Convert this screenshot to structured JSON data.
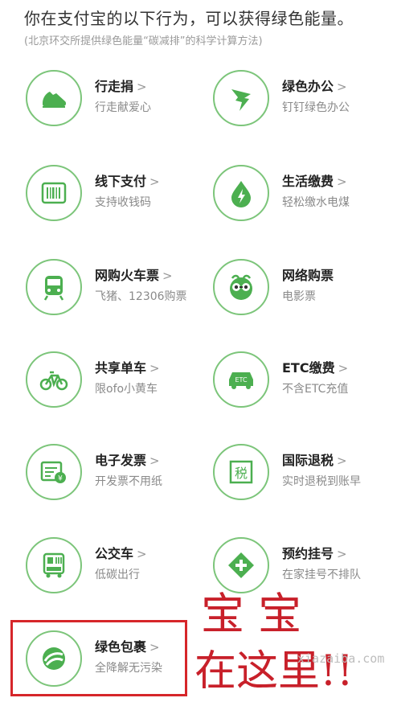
{
  "header": {
    "title": "你在支付宝的以下行为，可以获得绿色能量。",
    "subtitle": "(北京环交所提供绿色能量“碳减排”的科学计算方法)"
  },
  "colors": {
    "accent": "#4caf50",
    "ring": "#7cc57a",
    "highlight": "#d6262a",
    "scrawl": "#c8202a"
  },
  "items": [
    {
      "name": "行走捐",
      "desc": "行走献爱心",
      "icon": "shoe-icon"
    },
    {
      "name": "绿色办公",
      "desc": "钉钉绿色办公",
      "icon": "dingtalk-icon"
    },
    {
      "name": "线下支付",
      "desc": "支持收钱码",
      "icon": "barcode-icon"
    },
    {
      "name": "生活缴费",
      "desc": "轻松缴水电煤",
      "icon": "water-drop-icon"
    },
    {
      "name": "网购火车票",
      "desc": "飞猪、12306购票",
      "icon": "train-icon"
    },
    {
      "name": "网络购票",
      "desc": "电影票",
      "icon": "glasses-icon"
    },
    {
      "name": "共享单车",
      "desc": "限ofo小黄车",
      "icon": "bicycle-icon"
    },
    {
      "name": "ETC缴费",
      "desc": "不含ETC充值",
      "icon": "etc-car-icon"
    },
    {
      "name": "电子发票",
      "desc": "开发票不用纸",
      "icon": "invoice-icon"
    },
    {
      "name": "国际退税",
      "desc": "实时退税到账早",
      "icon": "tax-icon"
    },
    {
      "name": "公交车",
      "desc": "低碳出行",
      "icon": "bus-icon"
    },
    {
      "name": "预约挂号",
      "desc": "在家挂号不排队",
      "icon": "medical-plus-icon"
    },
    {
      "name": "绿色包裹",
      "desc": "全降解无污染",
      "icon": "package-icon"
    }
  ],
  "arrow": ">",
  "annotation": {
    "line1": "宝 宝",
    "line2": "在这里!!"
  },
  "etc_label": "ETC",
  "tax_char": "税",
  "invoice_char": "¥",
  "watermark": "xiazaiba.com"
}
